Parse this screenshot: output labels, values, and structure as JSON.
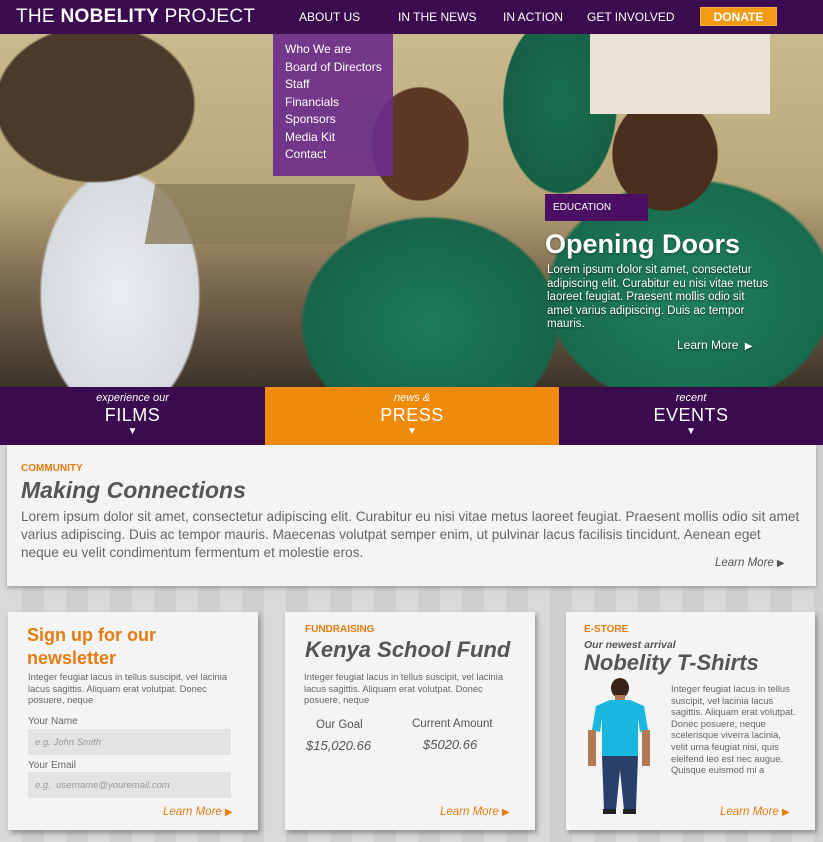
{
  "header": {
    "logo_prefix": "THE",
    "logo_bold": "NOBELITY",
    "logo_suffix": "PROJECT",
    "nav": [
      "ABOUT US",
      "IN THE NEWS",
      "IN ACTION",
      "GET INVOLVED"
    ],
    "donate_label": "DONATE"
  },
  "dropdown": [
    "Who We are",
    "Board of Directors",
    "Staff",
    "Financials",
    "Sponsors",
    "Media Kit",
    "Contact"
  ],
  "hero": {
    "tag": "EDUCATION",
    "title": "Opening Doors",
    "text": "Lorem ipsum dolor sit amet, consectetur adipiscing elit. Curabitur eu nisi vitae metus laoreet feugiat. Praesent mollis odio sit amet varius adipiscing. Duis ac tempor mauris.",
    "learn_more": "Learn More"
  },
  "tabs": [
    {
      "small": "experience our",
      "big": "FILMS"
    },
    {
      "small": "news &",
      "big": "PRESS"
    },
    {
      "small": "recent",
      "big": "EVENTS"
    }
  ],
  "community": {
    "label": "COMMUNITY",
    "title": "Making Connections",
    "text": "Lorem ipsum dolor sit amet, consectetur adipiscing elit. Curabitur eu nisi vitae metus laoreet feugiat. Praesent mollis odio sit amet varius adipiscing. Duis ac tempor mauris. Maecenas volutpat semper enim, ut pulvinar lacus facilisis tincidunt. Aenean eget neque eu velit condimentum fermentum et molestie eros.",
    "learn_more": "Learn More"
  },
  "newsletter": {
    "title": "Sign up for our newsletter",
    "text": "Integer feugiat lacus in tellus suscipit, vel lacinia lacus sagittis. Aliquam erat volutpat. Donec posuere, neque",
    "name_label": "Your Name",
    "name_placeholder": "e.g. John Smith",
    "email_label": "Your Email",
    "email_placeholder": "e.g.  username@youremail.com",
    "learn_more": "Learn More"
  },
  "fundraising": {
    "label": "FUNDRAISING",
    "title": "Kenya School Fund",
    "text": "Integer feugiat lacus in tellus suscipit, vel lacinia lacus sagittis. Aliquam erat volutpat. Donec posuere, neque",
    "goal_label": "Our Goal",
    "goal_value": "$15,020.66",
    "current_label": "Current Amount",
    "current_value": "$5020.66",
    "learn_more": "Learn More"
  },
  "estore": {
    "label": "E-STORE",
    "subtitle": "Our newest arrival",
    "title": "Nobelity T-Shirts",
    "text": "Integer feugiat lacus in tellus suscipit, vel lacinia lacus sagittis. Aliquam erat volutpat. Donec posuere, neque scelerisque viverra lacinia, velit urna feugiat nisi, quis eleifend leo est nec augue. Quisque euismod mi a",
    "learn_more": "Learn More"
  },
  "colors": {
    "purple": "#3a0b4f",
    "orange": "#f08a0b",
    "donate": "#f39a12",
    "shirt": "#19b6e0"
  }
}
